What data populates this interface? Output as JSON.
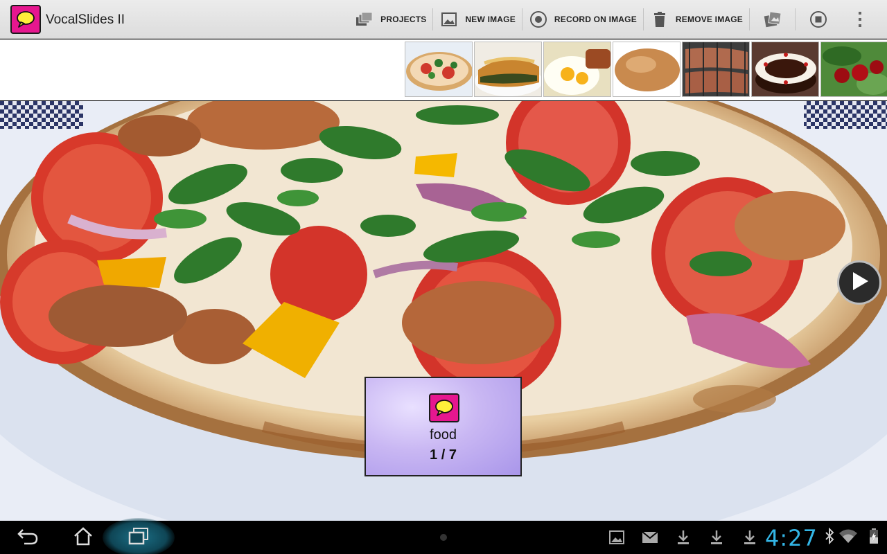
{
  "app": {
    "title": "VocalSlides II"
  },
  "actions": {
    "projects": "PROJECTS",
    "new_image": "NEW IMAGE",
    "record_on_image": "RECORD ON IMAGE",
    "remove_image": "REMOVE IMAGE"
  },
  "thumbnails": [
    "pizza",
    "lasagna",
    "fried-egg",
    "egg",
    "steak",
    "cake",
    "cherries"
  ],
  "caption": {
    "name": "food",
    "count": "1 / 7"
  },
  "status": {
    "time": "4:27"
  },
  "colors": {
    "accent": "#33b5e5",
    "logo": "#e6178f",
    "caption_bg": "#c9b7f3"
  }
}
